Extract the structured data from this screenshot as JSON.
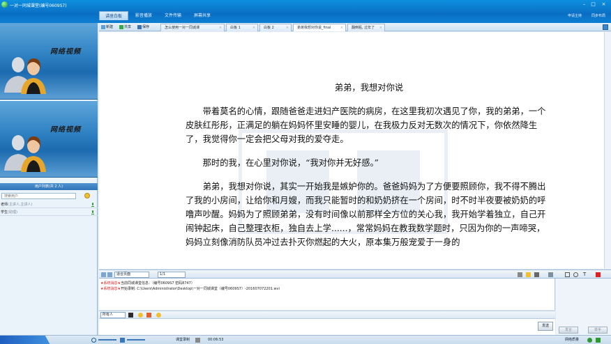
{
  "window": {
    "title": "一对一同城课堂(编号0609S7)",
    "top_tabs": [
      "讲座白板",
      "影音播放",
      "文件传输",
      "屏幕共享"
    ],
    "active_top_tab": 0,
    "top_right": [
      "申请主持",
      "同步布局"
    ]
  },
  "videos": [
    {
      "label": "网络视频"
    },
    {
      "label": "网络视频"
    }
  ],
  "user_list": {
    "header": "用户列表(共 2 人)",
    "search_placeholder": "搜索用户",
    "users": [
      {
        "name": "老师",
        "role": "(主讲人,主讲人)"
      },
      {
        "name": "学生",
        "role": "(助理)"
      }
    ]
  },
  "doc_toolbar": {
    "new_label": "新建",
    "share_label": "共享",
    "save_label": "保存",
    "tabs": [
      "怎么使用一对一同城课",
      "白板 1",
      "白板 2",
      "弟弟我想对你说_final",
      "翻倒瓶, 过年了"
    ],
    "active_tab": 3
  },
  "document": {
    "title": "弟弟，我想对你说",
    "paragraphs": [
      "带着莫名的心情，跟随爸爸走进妇产医院的病房，在这里我初次遇见了你，我的弟弟，一个皮肤红彤彤，正满足的躺在妈妈怀里安睡的婴儿，在我极力反对无数次的情况下，你依然降生了，我觉得你一定会把父母对我的爱夺走。",
      "那时的我，在心里对你说，“我对你并无好感。”",
      "弟弟，我想对你说，其实一开始我是嫉妒你的。爸爸妈妈为了方便要照顾你，我不得不腾出了我的小房间，让给你和月嫂，而我只能暂时的和奶奶挤在一个房间，时不时半夜要被奶奶的呼噜声吵醒。妈妈为了照顾弟弟，没有时间像以前那样全方位的关心我，我开始学着独立，自己开闹钟起床，自己整理衣柜，独自去上学......，常常妈妈在教我数学题时，只因为你的一声啼哭，妈妈立刻像消防队员冲过去扑灭你燃起的大火，原本集万般宠爱于一身的"
    ]
  },
  "annot_toolbar": {
    "fit_select": "适合页面",
    "page_select": "1/1"
  },
  "messages": [
    {
      "sys": "★系统消息★",
      "text": "当前同城课堂信息：（编号0609S7 密码8747）"
    },
    {
      "sys": "★系统消息★",
      "text": "开始录制: C:\\Users\\Administrator\\Desktop\\一对一同城课堂（编号0609S7）-201607072201.wvi"
    }
  ],
  "chat_input": {
    "to_select": "所有人",
    "send_label": "发送"
  },
  "right_buttons": [
    "发言",
    "举手"
  ],
  "status_bar": {
    "record_label": "课堂录制",
    "record_time": "00:06:53",
    "network_label": "网络质量"
  },
  "colors": {
    "title_bar": "#0a6fc4",
    "system_message": "#e21e1e",
    "video_bg": "#2c7fc1"
  }
}
